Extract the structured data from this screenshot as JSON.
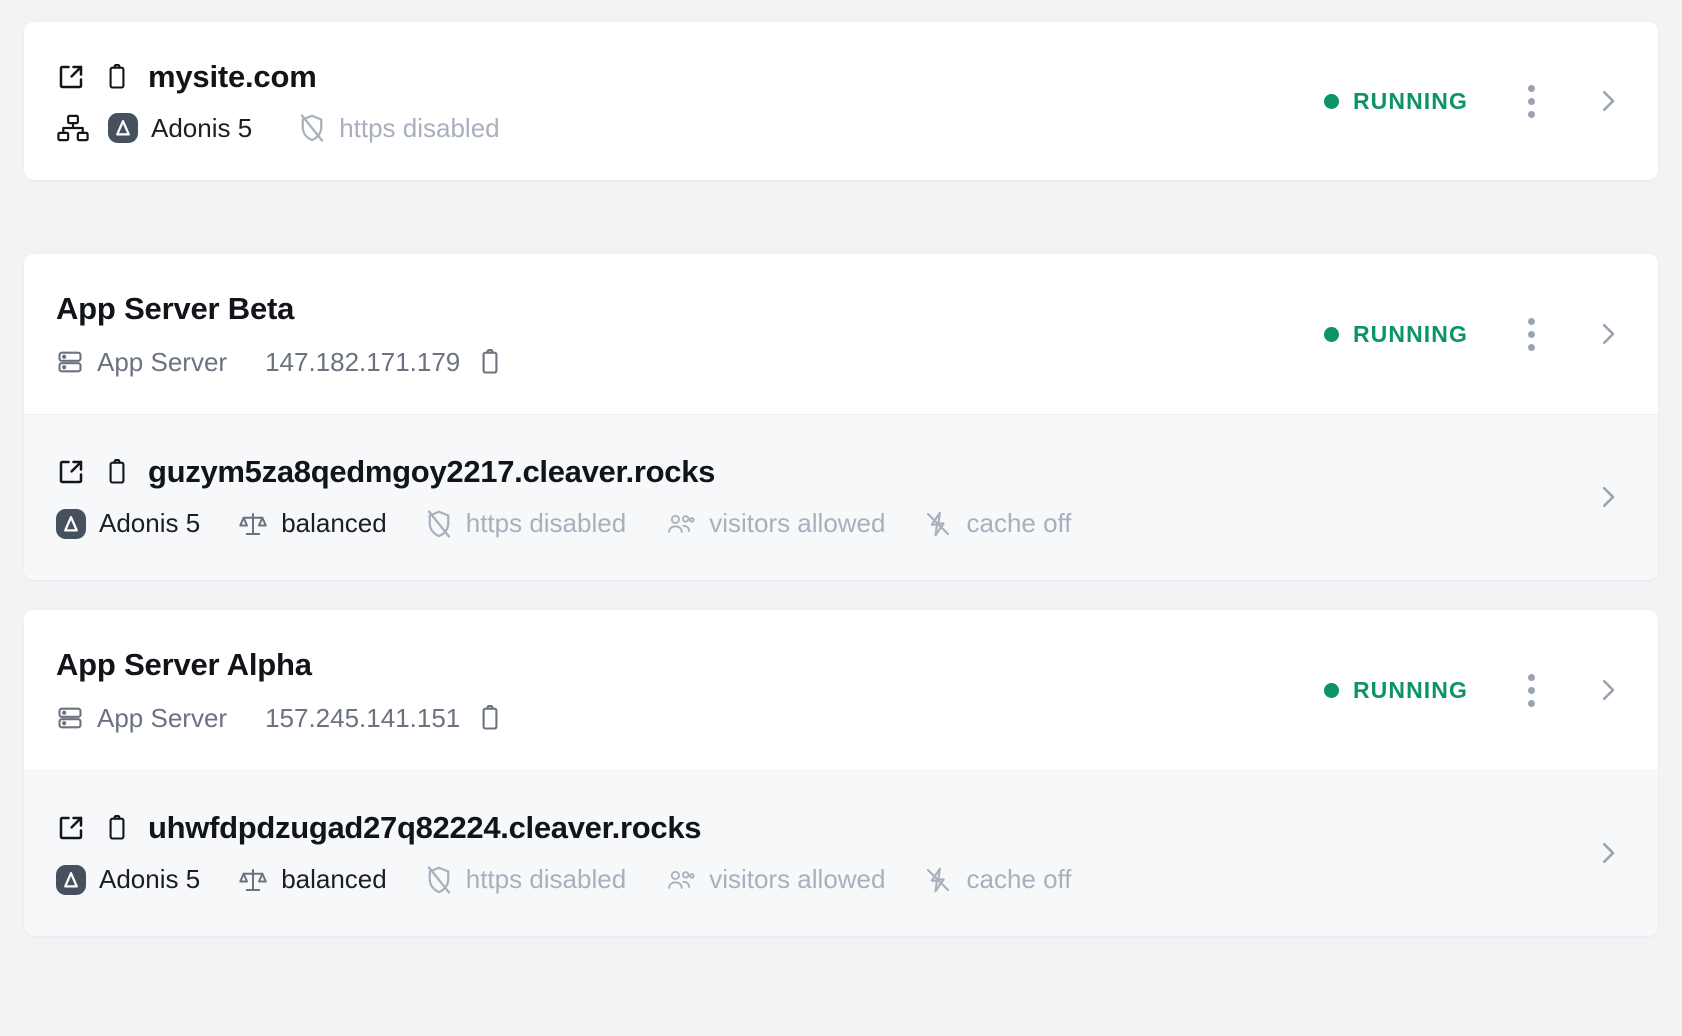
{
  "theme": {
    "page_bg": "#f1f3f5",
    "card_bg": "#ffffff",
    "subrow_bg": "#f7f8fa",
    "status_green": "#0d9466",
    "muted_text": "#a8b0bd",
    "meta_text": "#6b7380",
    "title_text": "#111418"
  },
  "labels": {
    "status_running": "RUNNING",
    "app_server_type": "App Server",
    "framework": "Adonis 5",
    "balanced": "balanced",
    "https_disabled": "https disabled",
    "visitors_allowed": "visitors allowed",
    "cache_off": "cache off"
  },
  "icons": {
    "external_link": "external-link-icon",
    "clipboard": "clipboard-icon",
    "sitemap": "sitemap-icon",
    "adonis": "adonis-logo-icon",
    "shield_off": "shield-off-icon",
    "server": "server-icon",
    "scale": "scale-balance-icon",
    "users": "users-icon",
    "zap_off": "zap-off-icon",
    "kebab": "kebab-menu-icon",
    "chevron_right": "chevron-right-icon",
    "status_dot": "status-dot-icon"
  },
  "cards": [
    {
      "kind": "site",
      "title": "mysite.com",
      "meta": {
        "framework": "Adonis 5",
        "https": "https disabled"
      },
      "status": "RUNNING"
    },
    {
      "kind": "server",
      "title": "App Server Beta",
      "type_label": "App Server",
      "ip": "147.182.171.179",
      "status": "RUNNING",
      "domain": {
        "name": "guzym5za8qedmgoy2217.cleaver.rocks",
        "framework": "Adonis 5",
        "balance": "balanced",
        "https": "https disabled",
        "visitors": "visitors allowed",
        "cache": "cache off"
      }
    },
    {
      "kind": "server",
      "title": "App Server Alpha",
      "type_label": "App Server",
      "ip": "157.245.141.151",
      "status": "RUNNING",
      "domain": {
        "name": "uhwfdpdzugad27q82224.cleaver.rocks",
        "framework": "Adonis 5",
        "balance": "balanced",
        "https": "https disabled",
        "visitors": "visitors allowed",
        "cache": "cache off"
      }
    }
  ]
}
